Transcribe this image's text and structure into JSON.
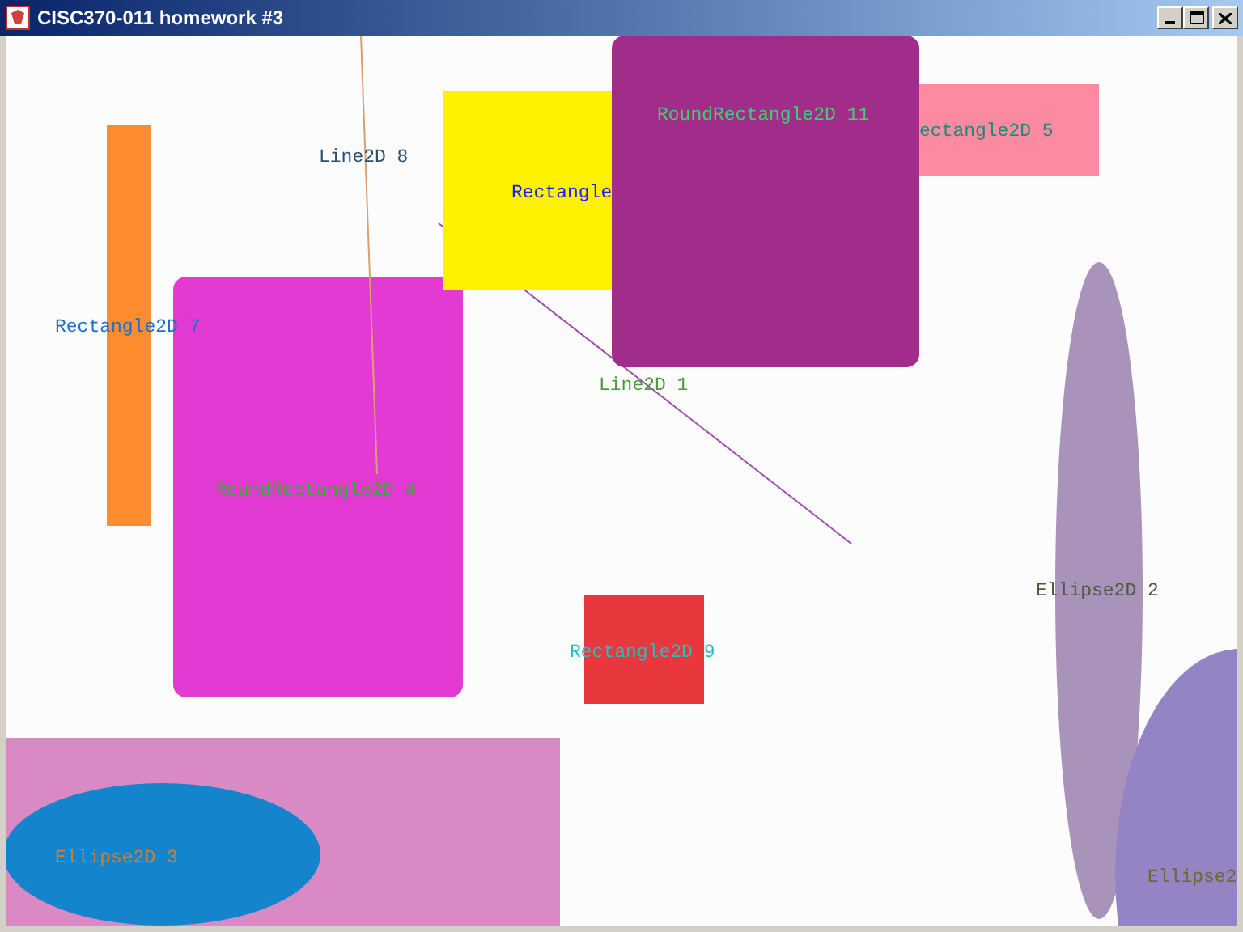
{
  "window": {
    "title": "CISC370-011 homework #3"
  },
  "shapes": [
    {
      "kind": "rectangle",
      "color": "#fc8aa0"
    },
    {
      "kind": "rectangle",
      "color": "#ff8c2e"
    },
    {
      "kind": "round_rectangle",
      "color": "#e33ad4"
    },
    {
      "kind": "line",
      "color": "#d8a070"
    },
    {
      "kind": "line",
      "color": "#a050b0"
    },
    {
      "kind": "rectangle",
      "color": "#fff200"
    },
    {
      "kind": "round_rectangle",
      "color": "#a22c8a"
    },
    {
      "kind": "rectangle",
      "color": "#e8383e"
    },
    {
      "kind": "ellipse",
      "color": "#aa93bb"
    },
    {
      "kind": "ellipse",
      "color": "#9484c4"
    },
    {
      "kind": "rectangle",
      "color": "#d98ac4"
    },
    {
      "kind": "ellipse",
      "color": "#1484cc"
    }
  ],
  "labels": [
    {
      "text": "RoundRectangle2D 11",
      "color": "#40d070"
    },
    {
      "text": "ectangle2D 5",
      "color": "#1a8a7a"
    },
    {
      "text": "Line2D 8",
      "color": "#2a5070"
    },
    {
      "text": "Rectangle",
      "color": "#1a1aff"
    },
    {
      "text": "Rectangle2D 7",
      "color": "#1a6fd0"
    },
    {
      "text": "Line2D 1",
      "color": "#4a9a3a"
    },
    {
      "text": "RoundRectangle2D 4",
      "color": "#22b822"
    },
    {
      "text": "Ellipse2D 2",
      "color": "#4a5a3a"
    },
    {
      "text": "Rectangle2D 9",
      "color": "#20c0c0"
    },
    {
      "text": "Ellipse2D 3",
      "color": "#e07a20"
    },
    {
      "text": "Ellipse2",
      "color": "#6a6a30"
    }
  ]
}
